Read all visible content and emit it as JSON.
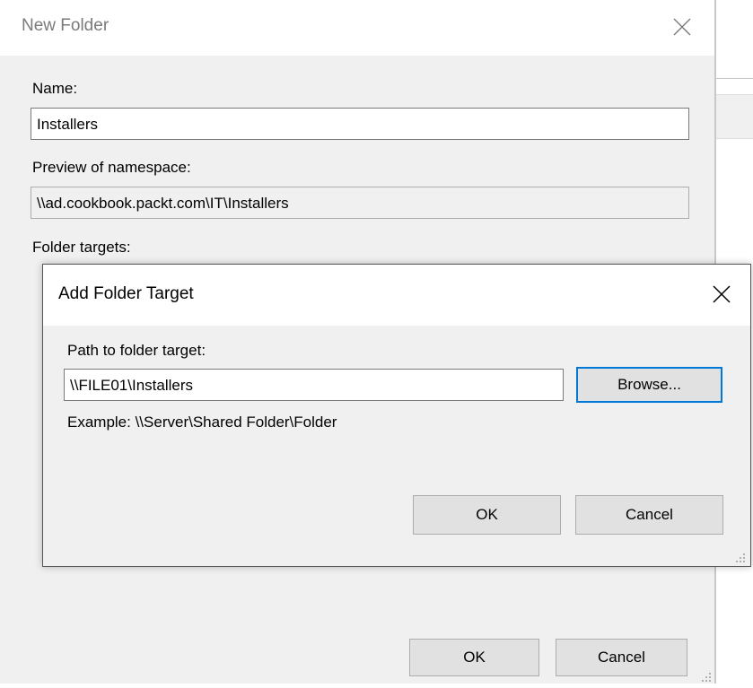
{
  "new_folder": {
    "title": "New Folder",
    "name_label": "Name:",
    "name_value": "Installers",
    "preview_label": "Preview of namespace:",
    "preview_value": "\\\\ad.cookbook.packt.com\\IT\\Installers",
    "targets_label": "Folder targets:",
    "ok_label": "OK",
    "cancel_label": "Cancel",
    "close_icon": "close-icon"
  },
  "add_folder_target": {
    "title": "Add Folder Target",
    "path_label": "Path to folder target:",
    "path_value": "\\\\FILE01\\Installers",
    "browse_label": "Browse...",
    "example_text": "Example: \\\\Server\\Shared Folder\\Folder",
    "ok_label": "OK",
    "cancel_label": "Cancel",
    "close_icon": "close-icon"
  },
  "colors": {
    "dialog_body": "#f0f0f0",
    "focus_border": "#0078d7",
    "button_face": "#e1e1e1"
  }
}
